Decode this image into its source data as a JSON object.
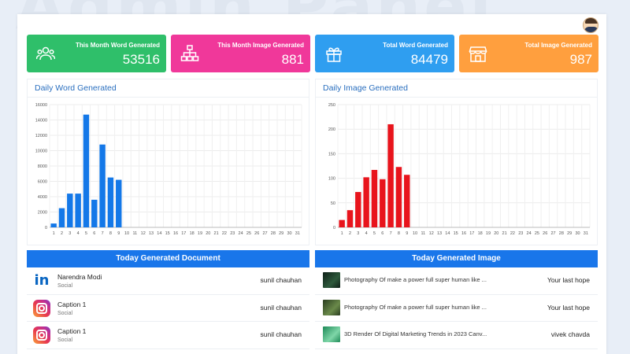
{
  "watermark": "Admin Panel",
  "cards": [
    {
      "title": "This Month Word Generated",
      "value": "53516",
      "icon": "users-icon",
      "color": "#2fbf6a"
    },
    {
      "title": "This Month Image Generated",
      "value": "881",
      "icon": "sitemap-icon",
      "color": "#f0389a"
    },
    {
      "title": "Total Word Generated",
      "value": "84479",
      "icon": "gift-icon",
      "color": "#2f9ef0"
    },
    {
      "title": "Total Image Generated",
      "value": "987",
      "icon": "store-icon",
      "color": "#ff9f3e"
    }
  ],
  "chart_data": [
    {
      "type": "bar",
      "title": "Daily Word Generated",
      "color": "#1478e8",
      "categories": [
        "1",
        "2",
        "3",
        "4",
        "5",
        "6",
        "7",
        "8",
        "9",
        "10",
        "11",
        "12",
        "13",
        "14",
        "15",
        "16",
        "17",
        "18",
        "19",
        "20",
        "21",
        "22",
        "23",
        "24",
        "25",
        "26",
        "27",
        "28",
        "29",
        "30",
        "31"
      ],
      "values": [
        500,
        2500,
        4400,
        4400,
        14700,
        3600,
        10800,
        6500,
        6200,
        0,
        0,
        0,
        0,
        0,
        0,
        0,
        0,
        0,
        0,
        0,
        0,
        0,
        0,
        0,
        0,
        0,
        0,
        0,
        0,
        0,
        0
      ],
      "ylim": [
        0,
        16000
      ],
      "yticks": [
        0,
        2000,
        4000,
        6000,
        8000,
        10000,
        12000,
        14000,
        16000
      ],
      "grid": true
    },
    {
      "type": "bar",
      "title": "Daily Image Generated",
      "color": "#e8141c",
      "categories": [
        "1",
        "2",
        "3",
        "4",
        "5",
        "6",
        "7",
        "8",
        "9",
        "10",
        "11",
        "12",
        "13",
        "14",
        "15",
        "16",
        "17",
        "18",
        "19",
        "20",
        "21",
        "22",
        "23",
        "24",
        "25",
        "26",
        "27",
        "28",
        "29",
        "30",
        "31"
      ],
      "values": [
        15,
        35,
        72,
        102,
        117,
        98,
        210,
        123,
        107,
        0,
        0,
        0,
        0,
        0,
        0,
        0,
        0,
        0,
        0,
        0,
        0,
        0,
        0,
        0,
        0,
        0,
        0,
        0,
        0,
        0,
        0
      ],
      "ylim": [
        0,
        250
      ],
      "yticks": [
        0,
        50,
        100,
        150,
        200,
        250
      ],
      "grid": true
    }
  ],
  "documents": {
    "header": "Today Generated Document",
    "rows": [
      {
        "name": "Narendra Modi",
        "category": "Social",
        "user": "sunil chauhan",
        "icon": "linkedin-icon"
      },
      {
        "name": "Caption 1",
        "category": "Social",
        "user": "sunil chauhan",
        "icon": "instagram-icon"
      },
      {
        "name": "Caption 1",
        "category": "Social",
        "user": "sunil chauhan",
        "icon": "instagram-icon"
      }
    ]
  },
  "images": {
    "header": "Today Generated Image",
    "rows": [
      {
        "prompt": "Photography Of make a power full super human like ...",
        "user": "Your last hope",
        "thumb_color": "#1f3a2a"
      },
      {
        "prompt": "Photography Of make a power full super human like ...",
        "user": "Your last hope",
        "thumb_color": "#3d5c2e"
      },
      {
        "prompt": "3D Render Of Digital Marketing Trends in 2023 Canv...",
        "user": "vivek chavda",
        "thumb_color": "#2e9e6a"
      }
    ]
  }
}
